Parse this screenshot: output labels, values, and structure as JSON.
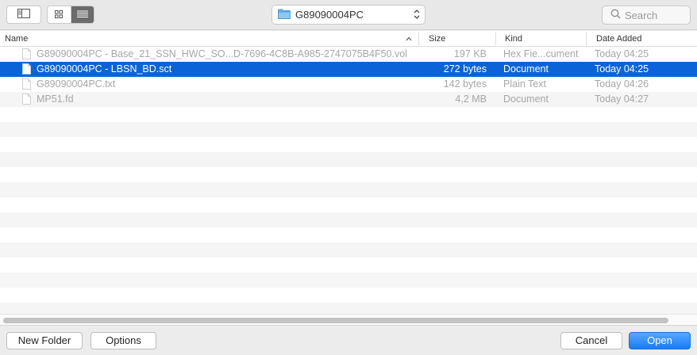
{
  "toolbar": {
    "location": "G89090004PC",
    "search_placeholder": "Search"
  },
  "columns": {
    "name": "Name",
    "size": "Size",
    "kind": "Kind",
    "date_added": "Date Added"
  },
  "files": [
    {
      "name": "G89090004PC - Base_21_SSN_HWC_SO...D-7696-4C8B-A985-2747075B4F50.vol",
      "size": "197 KB",
      "kind": "Hex Fie...cument",
      "date": "Today 04:25",
      "selected": false
    },
    {
      "name": "G89090004PC - LBSN_BD.sct",
      "size": "272 bytes",
      "kind": "Document",
      "date": "Today 04:25",
      "selected": true
    },
    {
      "name": "G89090004PC.txt",
      "size": "142 bytes",
      "kind": "Plain Text",
      "date": "Today 04:26",
      "selected": false
    },
    {
      "name": "MP51.fd",
      "size": "4,2 MB",
      "kind": "Document",
      "date": "Today 04:27",
      "selected": false
    }
  ],
  "buttons": {
    "new_folder": "New Folder",
    "options": "Options",
    "cancel": "Cancel",
    "open": "Open"
  },
  "colors": {
    "selection": "#0b64d7",
    "primary_button": "#157dfb"
  }
}
